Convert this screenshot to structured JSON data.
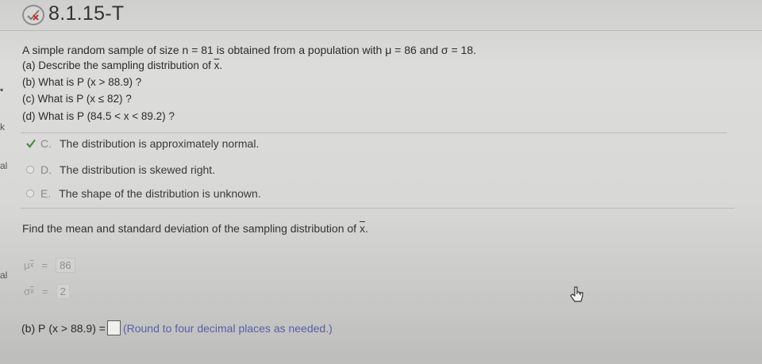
{
  "header": {
    "problem_id": "8.1.15-T",
    "status_icon": "partial-credit-icon"
  },
  "question": {
    "intro": "A simple random sample of size n = 81 is obtained from a population with μ = 86 and σ = 18.",
    "part_a_label": "(a)",
    "part_a_text": "Describe the sampling distribution of",
    "part_b_label": "(b)",
    "part_b_text": "What is P",
    "part_b_expr": "(x > 88.9) ?",
    "part_c_label": "(c)",
    "part_c_text": "What is P",
    "part_c_expr": "(x ≤ 82) ?",
    "part_d_label": "(d)",
    "part_d_text": "What is P",
    "part_d_expr": "(84.5 < x < 89.2) ?",
    "xbar": "x",
    "period": "."
  },
  "options": [
    {
      "letter": "C.",
      "text": "The distribution is approximately normal.",
      "selected": true
    },
    {
      "letter": "D.",
      "text": "The distribution is skewed right.",
      "selected": false
    },
    {
      "letter": "E.",
      "text": "The shape of the distribution is unknown.",
      "selected": false
    }
  ],
  "find": {
    "text": "Find the mean and standard deviation of the sampling distribution of",
    "xbar": "x",
    "period": "."
  },
  "results": {
    "mean_symbol": "μ",
    "mean_sub": "x",
    "mean_eq": "=",
    "mean_value": "86",
    "sd_symbol": "σ",
    "sd_sub": "x",
    "sd_eq": "=",
    "sd_value": "2"
  },
  "answer": {
    "label": "(b) P",
    "expr": "(x > 88.9) =",
    "hint": "(Round to four decimal places as needed.)"
  },
  "left_edge_marks": [
    "k",
    "al",
    "al"
  ],
  "colors": {
    "hint_text": "#5a5fa5",
    "check_green": "#4a8a3a",
    "background": "#d8d8d6"
  }
}
